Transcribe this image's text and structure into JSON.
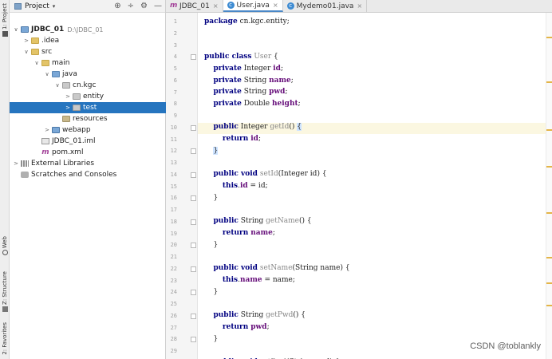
{
  "toolstrip": {
    "tabs": [
      "1: Project",
      "Web",
      "Z: Structure",
      "2: Favorites"
    ]
  },
  "project": {
    "title": "Project",
    "caret": "▾",
    "tools": [
      "⊕",
      "÷",
      "⚙",
      "—"
    ],
    "tree": [
      {
        "label": "JDBC_01",
        "sub": "D:\\JDBC_01",
        "bold": true,
        "indent": 0,
        "arrow": "∨",
        "icon": "proj"
      },
      {
        "label": ".idea",
        "indent": 1,
        "arrow": ">",
        "icon": "folder"
      },
      {
        "label": "src",
        "indent": 1,
        "arrow": "∨",
        "icon": "folder"
      },
      {
        "label": "main",
        "indent": 2,
        "arrow": "∨",
        "icon": "folder"
      },
      {
        "label": "java",
        "indent": 3,
        "arrow": "∨",
        "icon": "blue"
      },
      {
        "label": "cn.kgc",
        "indent": 4,
        "arrow": "∨",
        "icon": "pkg"
      },
      {
        "label": "entity",
        "indent": 5,
        "arrow": ">",
        "icon": "pkg"
      },
      {
        "label": "test",
        "indent": 5,
        "arrow": ">",
        "icon": "pkg",
        "selected": true
      },
      {
        "label": "resources",
        "indent": 4,
        "arrow": "",
        "icon": "res"
      },
      {
        "label": "webapp",
        "indent": 3,
        "arrow": ">",
        "icon": "web"
      },
      {
        "label": "JDBC_01.iml",
        "indent": 2,
        "arrow": "",
        "icon": "iml"
      },
      {
        "label": "pom.xml",
        "indent": 2,
        "arrow": "",
        "icon": "m"
      },
      {
        "label": "External Libraries",
        "indent": 0,
        "arrow": ">",
        "icon": "lib"
      },
      {
        "label": "Scratches and Consoles",
        "indent": 0,
        "arrow": "",
        "icon": "scr"
      }
    ]
  },
  "editor": {
    "tabs": [
      {
        "icon": "m",
        "label": "JDBC_01",
        "close": "×"
      },
      {
        "icon": "c",
        "label": "User.java",
        "close": "×",
        "active": true
      },
      {
        "icon": "c",
        "label": "Mydemo01.java",
        "close": "×"
      }
    ],
    "lines": [
      "1",
      "2",
      "3",
      "4",
      "5",
      "6",
      "7",
      "8",
      "9",
      "10",
      "11",
      "12",
      "13",
      "14",
      "15",
      "16",
      "17",
      "18",
      "19",
      "20",
      "21",
      "22",
      "23",
      "24",
      "25",
      "26",
      "27",
      "28",
      "29"
    ]
  },
  "watermark": "CSDN @toblankly"
}
